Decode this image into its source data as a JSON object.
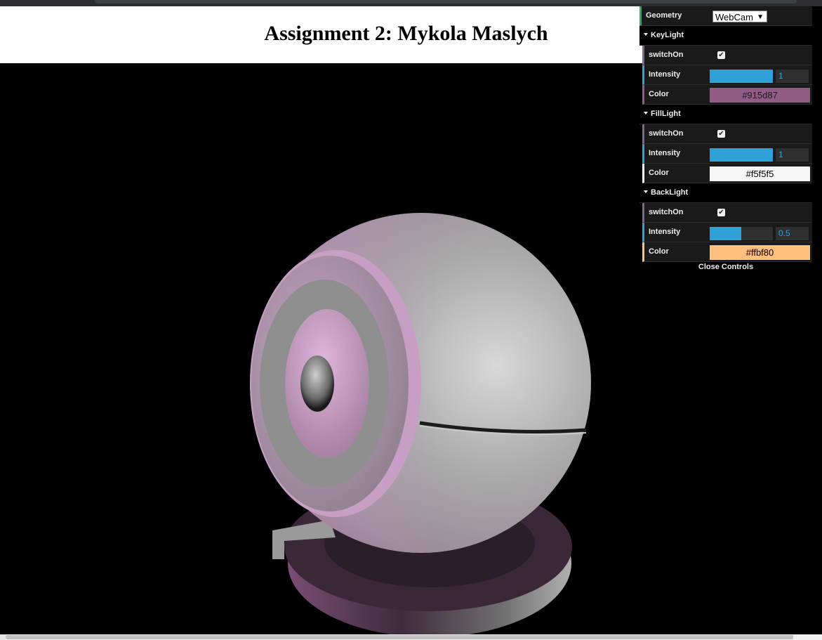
{
  "page": {
    "title": "Assignment 2: Mykola Maslych"
  },
  "gui": {
    "geometry": {
      "label": "Geometry",
      "value": "WebCam",
      "caret": "▼"
    },
    "folders": [
      {
        "name": "KeyLight",
        "switch_label": "switchOn",
        "switch_on": true,
        "intensity_label": "Intensity",
        "intensity": "1",
        "intensity_fraction": 1.0,
        "color_label": "Color",
        "color": "#915d87",
        "text_color": "#1a1a1a"
      },
      {
        "name": "FillLight",
        "switch_label": "switchOn",
        "switch_on": true,
        "intensity_label": "Intensity",
        "intensity": "1",
        "intensity_fraction": 1.0,
        "color_label": "Color",
        "color": "#f5f5f5",
        "text_color": "#000000"
      },
      {
        "name": "BackLight",
        "switch_label": "switchOn",
        "switch_on": true,
        "intensity_label": "Intensity",
        "intensity": "0.5",
        "intensity_fraction": 0.5,
        "color_label": "Color",
        "color": "#ffbf80",
        "text_color": "#000000"
      }
    ],
    "close_label": "Close Controls"
  },
  "icons": {
    "checkbox": "checkmark-icon",
    "folder": "caret-down-icon"
  }
}
